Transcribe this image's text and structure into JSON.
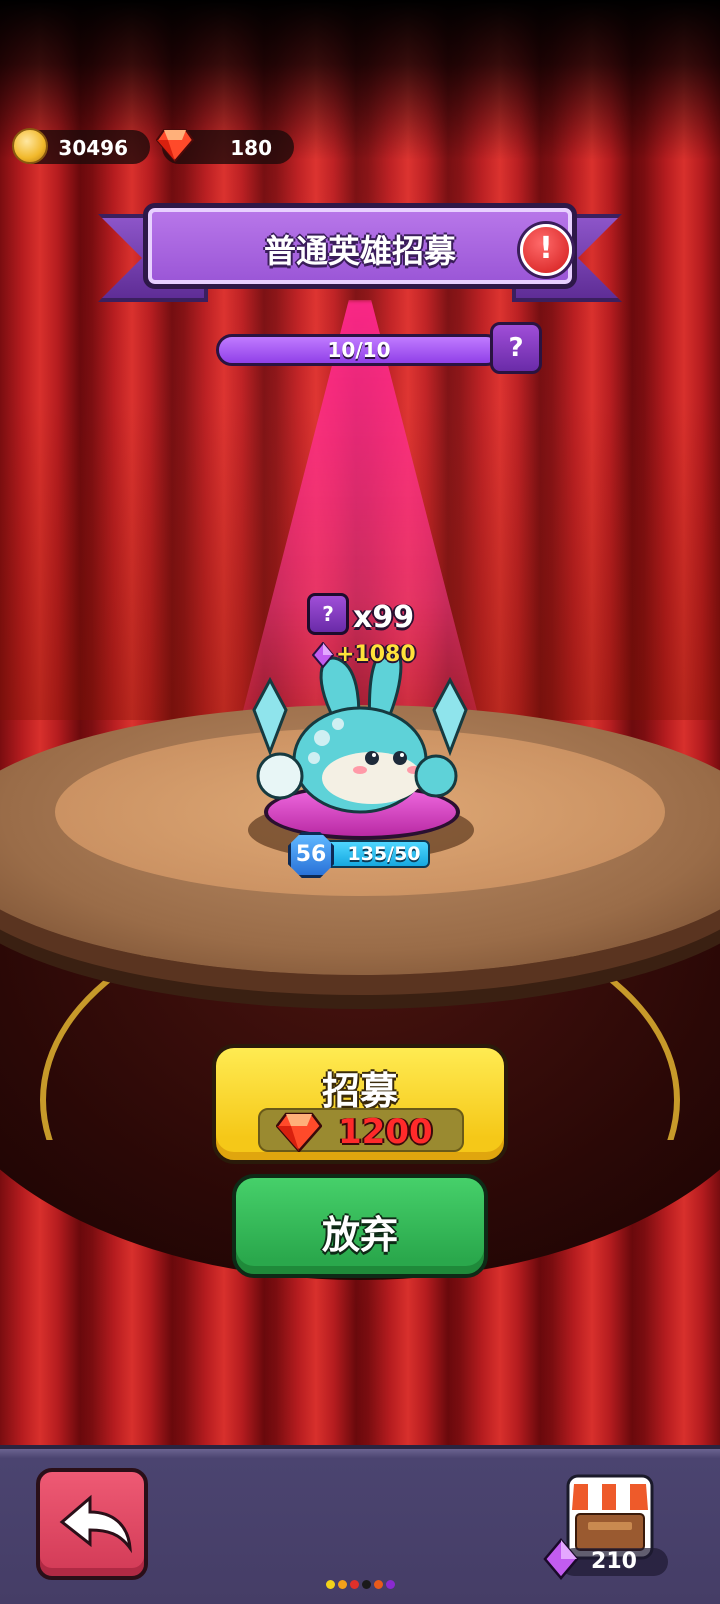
{
  "currencies": {
    "coins": "30496",
    "gems": "180"
  },
  "banner": {
    "title": "普通英雄招募"
  },
  "progress": {
    "text": "10/10",
    "fraction": 1.0
  },
  "reward": {
    "count": "x99",
    "bonus": "+1080"
  },
  "hero": {
    "level": "56",
    "exp": "135/50"
  },
  "actions": {
    "recruit_label": "招募",
    "recruit_cost": "1200",
    "abandon_label": "放弃"
  },
  "bottom": {
    "shop_gems": "210"
  },
  "page_dots": [
    "#f2d21a",
    "#f2a11a",
    "#e0302a",
    "#1a1a1a",
    "#e85a1a",
    "#8a2ad0"
  ],
  "colors": {
    "banner": "#a45ddc",
    "recruit_button": "#f8d82a",
    "abandon_button": "#36bc58",
    "back_button": "#de4863",
    "spotlight": "#ff2e90"
  },
  "icons": {
    "coin": "coin-icon",
    "gem": "red-gem-icon",
    "alert": "exclamation-icon",
    "help": "question-icon",
    "back": "back-arrow-icon",
    "shop": "shop-icon"
  }
}
